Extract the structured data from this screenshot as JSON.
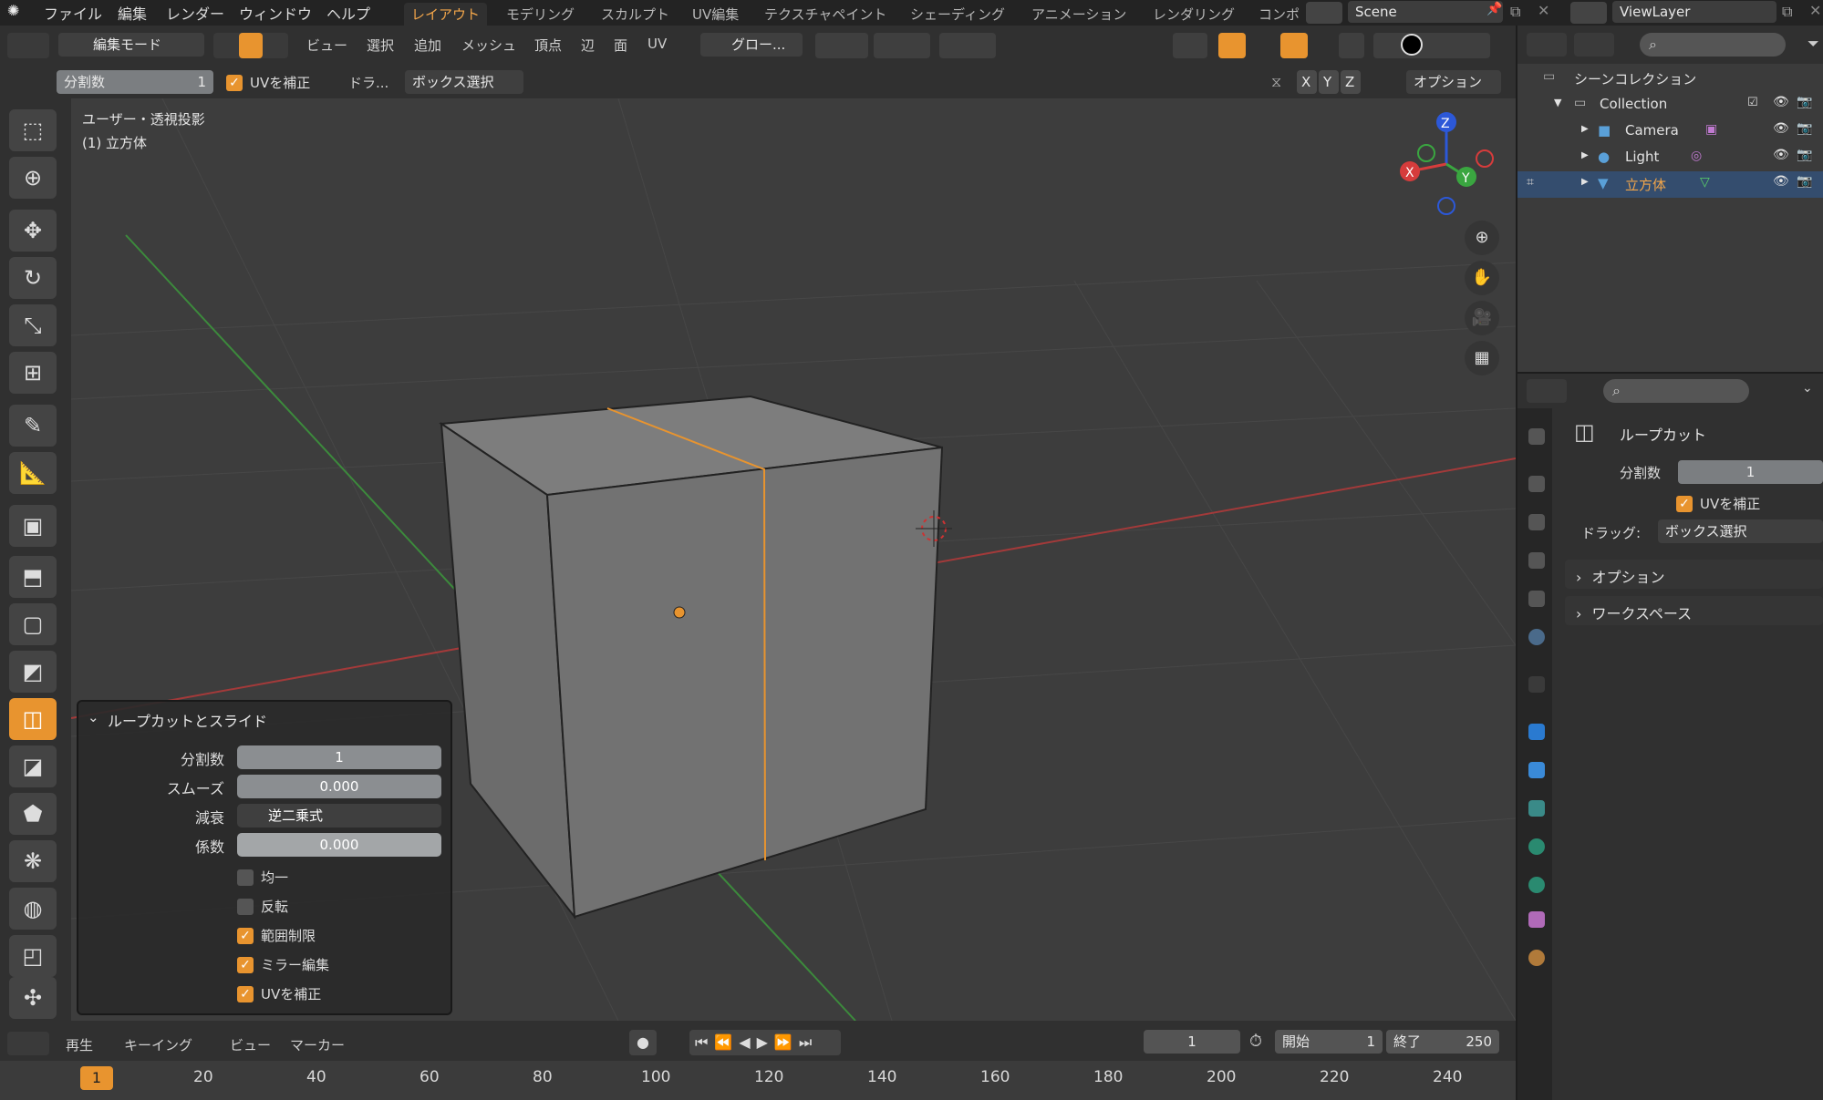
{
  "top_menu": [
    "ファイル",
    "編集",
    "レンダー",
    "ウィンドウ",
    "ヘルプ"
  ],
  "workspace_tabs": [
    "レイアウト",
    "モデリング",
    "スカルプト",
    "UV編集",
    "テクスチャペイント",
    "シェーディング",
    "アニメーション",
    "レンダリング",
    "コンポ"
  ],
  "scene_name": "Scene",
  "view_layer": "ViewLayer",
  "header": {
    "mode": "編集モード",
    "menus": [
      "ビュー",
      "選択",
      "追加",
      "メッシュ",
      "頂点",
      "辺",
      "面",
      "UV"
    ],
    "transform_orientation": "グロー...",
    "drag_label": "ドラ...",
    "box_select": "ボックス選択",
    "axes": [
      "X",
      "Y",
      "Z"
    ],
    "options": "オプション"
  },
  "tool_settings": {
    "cuts_label": "分割数",
    "cuts_value": "1",
    "correct_uv": "UVを補正"
  },
  "viewport": {
    "view_name": "ユーザー・透視投影",
    "object_info": "(1) 立方体",
    "gizmo_axes": [
      "X",
      "Y",
      "Z"
    ]
  },
  "loopcut_panel": {
    "title": "ループカットとスライド",
    "fields": [
      {
        "label": "分割数",
        "value": "1"
      },
      {
        "label": "スムーズ",
        "value": "0.000"
      },
      {
        "label": "減衰",
        "value": "逆二乗式"
      },
      {
        "label": "係数",
        "value": "0.000"
      }
    ],
    "checkboxes": [
      {
        "label": "均一",
        "checked": false
      },
      {
        "label": "反転",
        "checked": false
      },
      {
        "label": "範囲制限",
        "checked": true
      },
      {
        "label": "ミラー編集",
        "checked": true
      },
      {
        "label": "UVを補正",
        "checked": true
      }
    ]
  },
  "timeline": {
    "menus": [
      "再生",
      "キーイング",
      "ビュー",
      "マーカー"
    ],
    "current_frame": "1",
    "start_label": "開始",
    "start_value": "1",
    "end_label": "終了",
    "end_value": "250",
    "ruler": [
      "1",
      "20",
      "40",
      "60",
      "80",
      "100",
      "120",
      "140",
      "160",
      "180",
      "200",
      "220",
      "240"
    ]
  },
  "outliner": {
    "scene_collection": "シーンコレクション",
    "items": [
      "Collection",
      "Camera",
      "Light",
      "立方体"
    ]
  },
  "properties": {
    "tool_name": "ループカット",
    "cuts_label": "分割数",
    "cuts_value": "1",
    "correct_uv": "UVを補正",
    "drag_label": "ドラッグ:",
    "drag_value": "ボックス選択",
    "sections": [
      "オプション",
      "ワークスペース"
    ]
  },
  "colors": {
    "accent": "#e8942f",
    "selection": "#344d6e",
    "x_axis": "#d63c3c",
    "y_axis": "#3aa640",
    "z_axis": "#2c58d8"
  }
}
